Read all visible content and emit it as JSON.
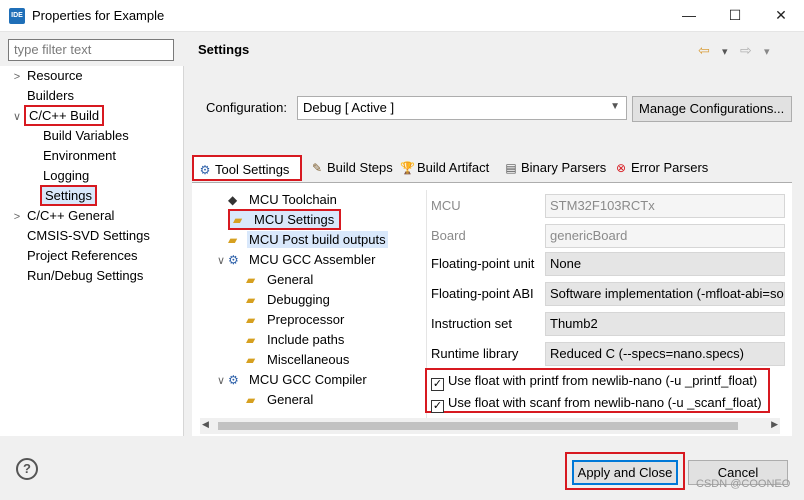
{
  "window": {
    "icon_text": "IDE",
    "title": "Properties for Example",
    "minimize": "—",
    "maximize": "☐",
    "close": "✕"
  },
  "filter": {
    "placeholder": "type filter text"
  },
  "left_tree": [
    {
      "label": "Resource",
      "chev": ">",
      "indent": 0
    },
    {
      "label": "Builders",
      "chev": "",
      "indent": 0
    },
    {
      "label": "C/C++ Build",
      "chev": "∨",
      "indent": 0
    },
    {
      "label": "Build Variables",
      "chev": "",
      "indent": 1
    },
    {
      "label": "Environment",
      "chev": "",
      "indent": 1
    },
    {
      "label": "Logging",
      "chev": "",
      "indent": 1
    },
    {
      "label": "Settings",
      "chev": "",
      "indent": 1
    },
    {
      "label": "C/C++ General",
      "chev": ">",
      "indent": 0
    },
    {
      "label": "CMSIS-SVD Settings",
      "chev": "",
      "indent": 0
    },
    {
      "label": "Project References",
      "chev": "",
      "indent": 0
    },
    {
      "label": "Run/Debug Settings",
      "chev": "",
      "indent": 0
    }
  ],
  "header": {
    "title": "Settings",
    "back": "⇦",
    "forward": "⇨",
    "menu": "▾"
  },
  "config": {
    "label": "Configuration:",
    "value": "Debug  [ Active ]",
    "manage_button": "Manage Configurations..."
  },
  "tabs": [
    {
      "label": "Tool Settings",
      "icon": "⚙"
    },
    {
      "label": "Build Steps",
      "icon": "✎"
    },
    {
      "label": "Build Artifact",
      "icon": "🏆"
    },
    {
      "label": "Binary Parsers",
      "icon": "▤"
    },
    {
      "label": "Error Parsers",
      "icon": "⊗"
    }
  ],
  "tool_tree": [
    {
      "label": "MCU Toolchain",
      "kind": "diamond"
    },
    {
      "label": "MCU Settings",
      "kind": "folder"
    },
    {
      "label": "MCU Post build outputs",
      "kind": "folder"
    },
    {
      "label": "MCU GCC Assembler",
      "kind": "gear"
    },
    {
      "label": "General",
      "kind": "folder"
    },
    {
      "label": "Debugging",
      "kind": "folder"
    },
    {
      "label": "Preprocessor",
      "kind": "folder"
    },
    {
      "label": "Include paths",
      "kind": "folder"
    },
    {
      "label": "Miscellaneous",
      "kind": "folder"
    },
    {
      "label": "MCU GCC Compiler",
      "kind": "gear"
    },
    {
      "label": "General",
      "kind": "folder"
    }
  ],
  "properties": [
    {
      "label": "MCU",
      "value": "STM32F103RCTx"
    },
    {
      "label": "Board",
      "value": "genericBoard"
    },
    {
      "label": "Floating-point unit",
      "value": "None"
    },
    {
      "label": "Floating-point ABI",
      "value": "Software implementation (-mfloat-abi=soft)"
    },
    {
      "label": "Instruction set",
      "value": "Thumb2"
    },
    {
      "label": "Runtime library",
      "value": "Reduced C (--specs=nano.specs)"
    }
  ],
  "checkboxes": [
    {
      "label": "Use float with printf from newlib-nano (-u _printf_float)",
      "checked": true
    },
    {
      "label": "Use float with scanf from newlib-nano (-u _scanf_float)",
      "checked": true
    }
  ],
  "footer": {
    "help": "?",
    "apply_close": "Apply and Close",
    "cancel": "Cancel",
    "watermark": "CSDN @COONEO"
  }
}
